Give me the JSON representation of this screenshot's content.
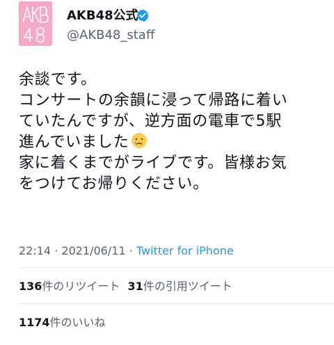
{
  "tweet": {
    "author": {
      "display_name": "AKB48公式",
      "handle": "@AKB48_staff",
      "avatar_text": "AKB48",
      "verified_icon": "verified-badge-icon"
    },
    "body_lines": [
      "余談です。",
      "コンサートの余韻に浸って帰路に着い",
      "ていたんですが、逆方面の電車で5駅",
      "進んでいました",
      "家に着くまでがライブです。皆様お気",
      "をつけてお帰りください。"
    ],
    "emoji": "crying-face-emoji",
    "time": "22:14",
    "date": "2021/06/11",
    "separator": "·",
    "source": "Twitter for iPhone"
  },
  "stats": {
    "retweets_count": "136",
    "retweets_label": "件のリツイート",
    "quotes_count": "31",
    "quotes_label": "件の引用ツイート",
    "likes_count": "1174",
    "likes_label": "件のいいね"
  },
  "colors": {
    "accent": "#1d9bf0",
    "avatar_pink": "#f5a9c4",
    "muted": "#536471"
  }
}
